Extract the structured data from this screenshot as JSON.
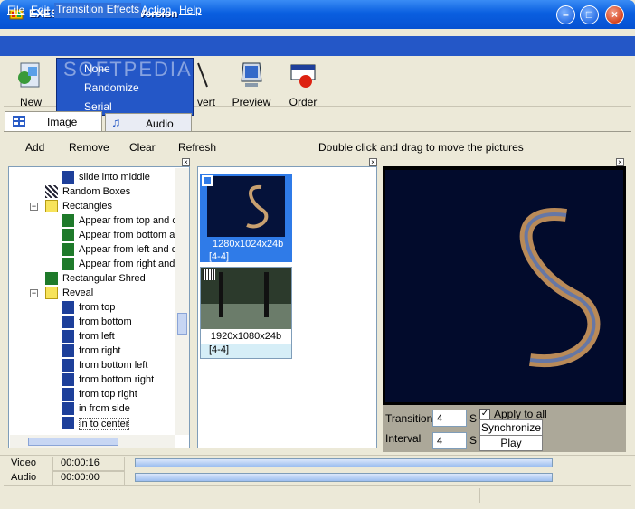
{
  "window": {
    "title": "EXESHOW-Freeware Version"
  },
  "menu": {
    "items": [
      "File",
      "Edit",
      "Transition Effects",
      "Action",
      "Help"
    ]
  },
  "dropdown": {
    "items": [
      "None",
      "Randomize",
      "Serial"
    ]
  },
  "toolbar": {
    "new": "New",
    "convert_partial": "vert",
    "preview": "Preview",
    "order": "Order"
  },
  "tabs": {
    "image": "Image",
    "audio": "Audio"
  },
  "actions": {
    "add": "Add",
    "remove": "Remove",
    "clear": "Clear",
    "refresh": "Refresh",
    "hint": "Double click and drag to move the pictures"
  },
  "tree": [
    {
      "label": "slide into middle",
      "level": 2
    },
    {
      "label": "Random Boxes",
      "level": 1
    },
    {
      "label": "Rectangles",
      "level": 1,
      "folder": true
    },
    {
      "label": "Appear from top and c",
      "level": 2
    },
    {
      "label": "Appear from bottom ar",
      "level": 2
    },
    {
      "label": "Appear from left and d",
      "level": 2
    },
    {
      "label": "Appear from right and",
      "level": 2
    },
    {
      "label": "Rectangular Shred",
      "level": 1
    },
    {
      "label": "Reveal",
      "level": 1,
      "folder": true
    },
    {
      "label": "from top",
      "level": 2
    },
    {
      "label": "from bottom",
      "level": 2
    },
    {
      "label": "from left",
      "level": 2
    },
    {
      "label": "from right",
      "level": 2
    },
    {
      "label": "from bottom left",
      "level": 2
    },
    {
      "label": "from bottom right",
      "level": 2
    },
    {
      "label": "from top right",
      "level": 2
    },
    {
      "label": "in from side",
      "level": 2
    },
    {
      "label": "in to center",
      "level": 2
    }
  ],
  "thumbs": [
    {
      "res": "1280x1024x24b",
      "range": "[4-4]"
    },
    {
      "res": "1920x1080x24b",
      "range": "[4-4]"
    }
  ],
  "controls": {
    "transition_label": "Transition",
    "transition_value": "4",
    "transition_unit": "S",
    "interval_label": "Interval",
    "interval_value": "4",
    "interval_unit": "S",
    "apply_all": "Apply to all",
    "synchronize": "Synchronize",
    "play": "Play"
  },
  "bottom": {
    "video_label": "Video",
    "video_time": "00:00:16",
    "audio_label": "Audio",
    "audio_time": "00:00:00"
  },
  "watermark": "SOFTPEDIA",
  "colors": {
    "titlebar": "#0a5fe0",
    "menubar": "#2457c7",
    "selection": "#2f7be8"
  }
}
